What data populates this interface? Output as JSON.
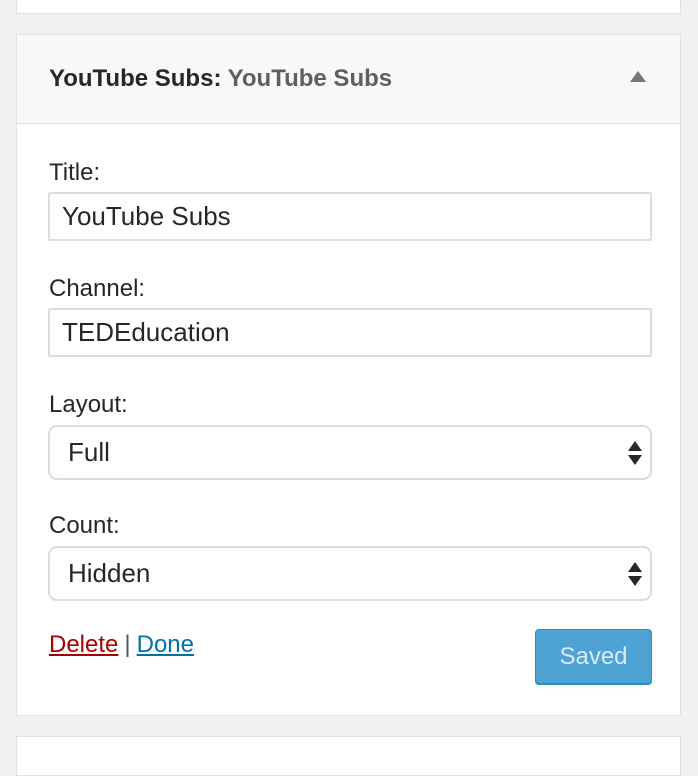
{
  "widget": {
    "name": "YouTube Subs",
    "title_separator": ":",
    "instance_title": "YouTube Subs"
  },
  "fields": {
    "title": {
      "label": "Title:",
      "value": "YouTube Subs"
    },
    "channel": {
      "label": "Channel:",
      "value": "TEDEducation"
    },
    "layout": {
      "label": "Layout:",
      "selected": "Full"
    },
    "count": {
      "label": "Count:",
      "selected": "Hidden"
    }
  },
  "actions": {
    "delete_label": "Delete",
    "separator": "|",
    "done_label": "Done",
    "save_label": "Saved"
  },
  "colors": {
    "delete_link": "#a00000",
    "done_link": "#0073aa",
    "save_button": "#4fa3d4"
  }
}
